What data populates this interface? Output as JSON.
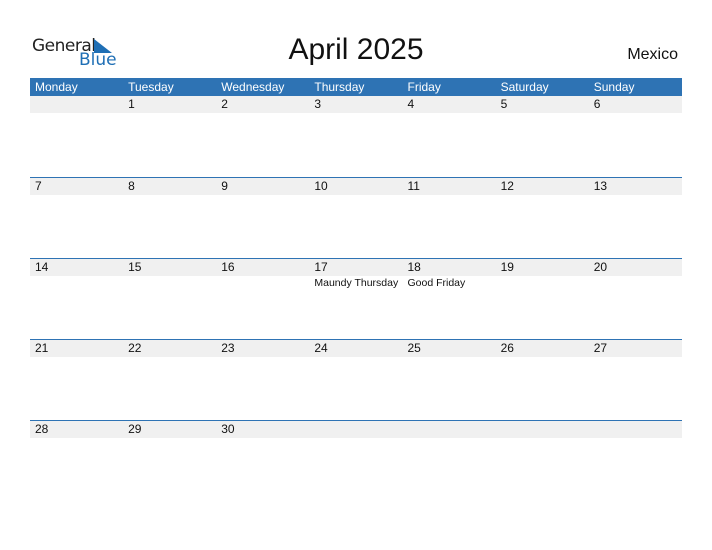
{
  "logo": {
    "general": "General",
    "blue": "Blue"
  },
  "title": "April 2025",
  "country": "Mexico",
  "days": [
    "Monday",
    "Tuesday",
    "Wednesday",
    "Thursday",
    "Friday",
    "Saturday",
    "Sunday"
  ],
  "weeks": [
    [
      "",
      "1",
      "2",
      "3",
      "4",
      "5",
      "6"
    ],
    [
      "7",
      "8",
      "9",
      "10",
      "11",
      "12",
      "13"
    ],
    [
      "14",
      "15",
      "16",
      "17",
      "18",
      "19",
      "20"
    ],
    [
      "21",
      "22",
      "23",
      "24",
      "25",
      "26",
      "27"
    ],
    [
      "28",
      "29",
      "30",
      "",
      "",
      "",
      ""
    ]
  ],
  "holidays": {
    "thursday_17": "Maundy Thursday",
    "friday_18": "Good Friday"
  }
}
